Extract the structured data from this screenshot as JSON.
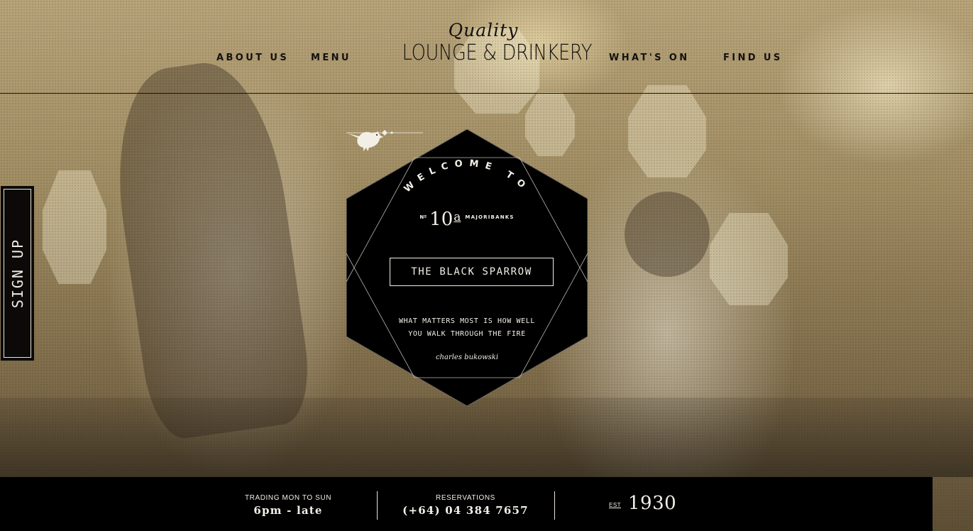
{
  "header": {
    "logo_script": "Quality",
    "logo_main": "LOUNGE & DRINKERY",
    "nav": {
      "about": "ABOUT US",
      "menu": "MENU",
      "whats_on": "WHAT'S ON",
      "find_us": "FIND US"
    }
  },
  "signup": {
    "label": "SIGN UP"
  },
  "badge": {
    "welcome": "WELCOME TO",
    "number_prefix": "Nº",
    "number": "10a",
    "street": "MAJORIBANKS",
    "name": "THE BLACK SPARROW",
    "quote_line1": "WHAT MATTERS MOST IS HOW WELL",
    "quote_line2": "YOU WALK THROUGH THE FIRE",
    "author": "charles bukowski"
  },
  "footer": {
    "trading_label": "TRADING MON TO SUN",
    "trading_value": "6pm - late",
    "reservations_label": "RESERVATIONS",
    "reservations_value": "(+64) 04 384 7657",
    "est_label": "EST",
    "est_year": "1930"
  },
  "colors": {
    "ink": "#141210",
    "badge_bg": "#000000",
    "badge_text": "#f3efe6",
    "footer_bg": "#000000"
  },
  "icons": [
    "sparrow-icon",
    "ornament-divider-icon"
  ]
}
